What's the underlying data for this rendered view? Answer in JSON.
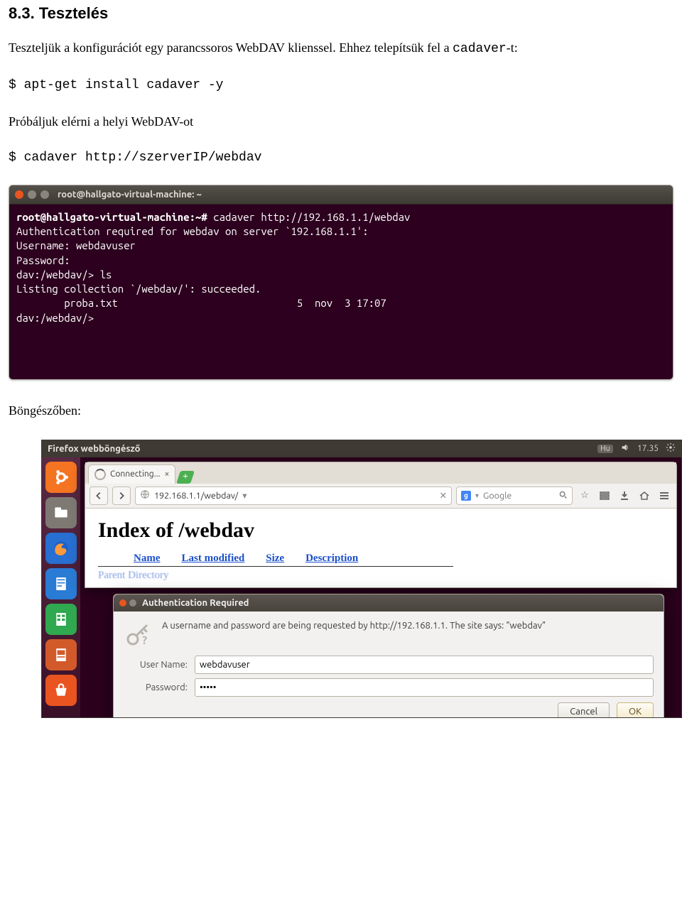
{
  "heading": "8.3. Tesztelés",
  "intro_parts": {
    "p1": "Teszteljük a konfigurációt egy parancssoros WebDAV klienssel. Ehhez telepítsük fel a ",
    "code": "cadaver",
    "p2": "-t:"
  },
  "cmd1": "$ apt-get install cadaver -y",
  "para2": "Próbáljuk elérni a helyi WebDAV-ot",
  "cmd2": "$ cadaver http://szerverIP/webdav",
  "terminal": {
    "title": "root@hallgato-virtual-machine: ~",
    "lines": {
      "l1_prompt": "root@hallgato-virtual-machine:~#",
      "l1_cmd": " cadaver http://192.168.1.1/webdav",
      "l2": "Authentication required for webdav on server `192.168.1.1':",
      "l3": "Username: webdavuser",
      "l4": "Password:",
      "l5": "dav:/webdav/> ls",
      "l6": "Listing collection `/webdav/': succeeded.",
      "l7": "        proba.txt                              5  nov  3 17:07",
      "l8": "dav:/webdav/>"
    }
  },
  "para3": "Böngészőben:",
  "desktop": {
    "app_title": "Firefox webböngésző",
    "indicators": {
      "hu": "Hu",
      "time": "17.35"
    },
    "tab_label": "Connecting...",
    "url": "192.168.1.1/webdav/",
    "search_placeholder": "Google",
    "index_title": "Index of /webdav",
    "cols": {
      "name": "Name",
      "lastmod": "Last modified",
      "size": "Size",
      "desc": "Description"
    },
    "parent_row": "Parent Directory",
    "dialog": {
      "title": "Authentication Required",
      "message": "A username and password are being requested by http://192.168.1.1. The site says: \"webdav\"",
      "user_label": "User Name:",
      "pass_label": "Password:",
      "user_value": "webdavuser",
      "pass_value": "•••••",
      "cancel": "Cancel",
      "ok": "OK"
    }
  }
}
